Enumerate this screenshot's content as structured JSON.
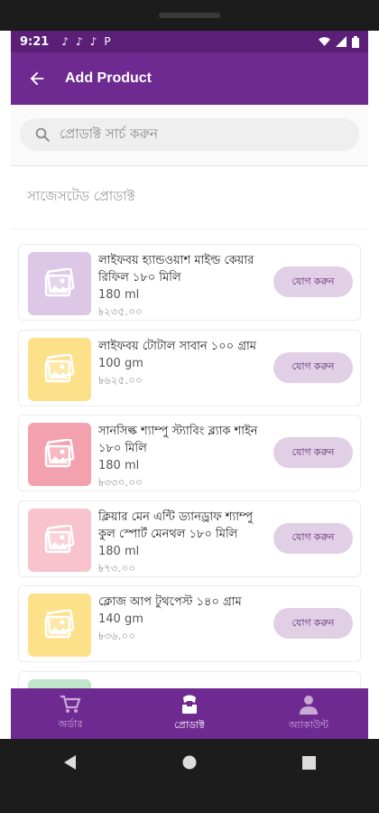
{
  "status_bar": {
    "time": "9:21",
    "notifications": [
      "♪",
      "♪",
      "♪",
      "P"
    ]
  },
  "app_bar": {
    "title": "Add Product"
  },
  "search": {
    "placeholder": "প্রোডাক্ট সার্চ করুন"
  },
  "section_title": "সাজেসটেড প্রোডাক্ট",
  "products": [
    {
      "name": "লাইফবয় হ্যান্ডওয়াশ মাইল্ড কেয়ার রিফিল ১৮০ মিলি",
      "qty": "180 ml",
      "price": "৳২৩৫.০০",
      "thumb_color": "#dcc7e6",
      "add_label": "যোগ করুন"
    },
    {
      "name": "লাইফবয় টোটাল সাবান ১০০ গ্রাম",
      "qty": "100 gm",
      "price": "৳৬২৫.০০",
      "thumb_color": "#fde08a",
      "add_label": "যোগ করুন"
    },
    {
      "name": "সানসিল্ক শ্যাম্পু স্ট্যাবিং ব্ল্যাক শাইন ১৮০ মিলি",
      "qty": "180 ml",
      "price": "৳৩৩০.০০",
      "thumb_color": "#f4a1ae",
      "add_label": "যোগ করুন"
    },
    {
      "name": "ক্লিয়ার মেন এন্টি ড্যানড্রাফ শ্যাম্পু কুল স্পোর্ট মেনথল ১৮০ মিলি",
      "qty": "180 ml",
      "price": "৳৭৩.০০",
      "thumb_color": "#f8c3cd",
      "add_label": "যোগ করুন"
    },
    {
      "name": "ক্লোজ আপ টুথপেস্ট ১৪০ গ্রাম",
      "qty": "140 gm",
      "price": "৳৩৬.০০",
      "thumb_color": "#fde08a",
      "add_label": "যোগ করুন"
    }
  ],
  "bottom_nav": [
    {
      "label": "অর্ডার",
      "icon": "cart-icon",
      "active": false
    },
    {
      "label": "প্রোডাক্ট",
      "icon": "product-icon",
      "active": true
    },
    {
      "label": "অ্যাকাউন্ট",
      "icon": "account-icon",
      "active": false
    }
  ],
  "colors": {
    "primary": "#6f2a91",
    "statusbar": "#5b1f78",
    "add_button_bg": "#e1cfe6",
    "add_button_text": "#5b2b73"
  }
}
